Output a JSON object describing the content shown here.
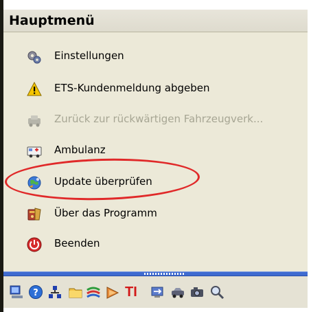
{
  "panel": {
    "title": "Hauptmenü"
  },
  "menu": {
    "items": [
      {
        "label": "Einstellungen",
        "icon": "settings-icon",
        "enabled": true
      },
      {
        "label": "ETS-Kundenmeldung abgeben",
        "icon": "warning-icon",
        "enabled": true
      },
      {
        "label": "Zurück zur rückwärtigen Fahrzeugverk...",
        "icon": "back-vehicle-icon",
        "enabled": false
      },
      {
        "label": "Ambulanz",
        "icon": "ambulance-icon",
        "enabled": true
      },
      {
        "label": "Update überprüfen",
        "icon": "update-globe-icon",
        "enabled": true
      },
      {
        "label": "Über das Programm",
        "icon": "about-icon",
        "enabled": true
      },
      {
        "label": "Beenden",
        "icon": "power-icon",
        "enabled": true
      }
    ]
  },
  "toolbar": {
    "icons": [
      "computer-icon",
      "help-icon",
      "network-icon",
      "folder-icon",
      "cables-icon",
      "tools-icon",
      "ti-text-icon",
      "transfer-icon",
      "car-icon",
      "camera-icon",
      "search-icon"
    ],
    "ti_label": "TI"
  },
  "colors": {
    "accent_highlight": "#e02929",
    "divider_blue": "#3f6bd0",
    "menu_bg": "#ece9d8",
    "disabled_text": "#a7a694"
  }
}
